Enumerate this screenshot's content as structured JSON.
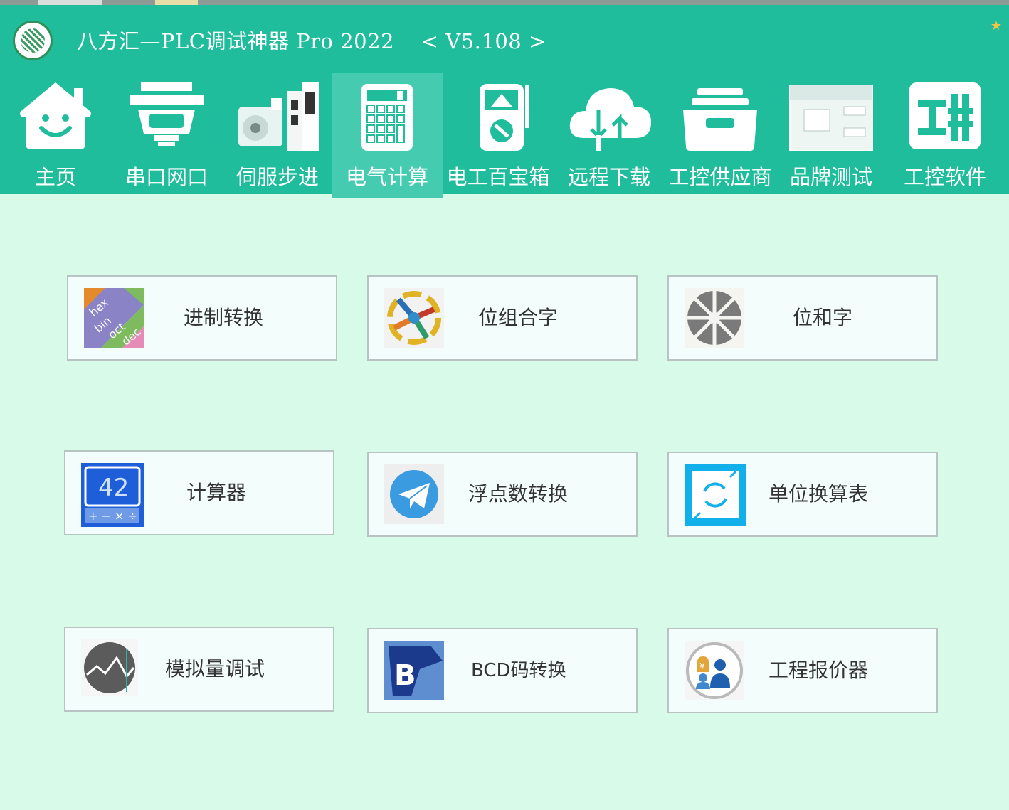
{
  "app": {
    "title": "八方汇—PLC调试神器 Pro 2022",
    "version": "< V5.108 >",
    "accent_color": "#1fbd9b",
    "background_color": "#d8fbe9"
  },
  "nav": {
    "items": [
      {
        "label": "主页",
        "icon": "home-icon"
      },
      {
        "label": "串口网口",
        "icon": "serial-port-icon"
      },
      {
        "label": "伺服步进",
        "icon": "servo-motor-icon"
      },
      {
        "label": "电气计算",
        "icon": "calculator-icon",
        "active": true
      },
      {
        "label": "电工百宝箱",
        "icon": "multimeter-icon"
      },
      {
        "label": "远程下载",
        "icon": "cloud-transfer-icon"
      },
      {
        "label": "工控供应商",
        "icon": "drawer-icon"
      },
      {
        "label": "品牌测试",
        "icon": "plc-device-icon"
      },
      {
        "label": "工控软件",
        "icon": "software-icon"
      }
    ]
  },
  "tools": [
    {
      "label": "进制转换",
      "icon": "base-conversion-icon"
    },
    {
      "label": "位组合字",
      "icon": "bit-combine-icon"
    },
    {
      "label": "位和字",
      "icon": "bit-word-icon"
    },
    {
      "label": "计算器",
      "icon": "calculator-app-icon"
    },
    {
      "label": "浮点数转换",
      "icon": "float-convert-icon"
    },
    {
      "label": "单位换算表",
      "icon": "unit-table-icon"
    },
    {
      "label": "模拟量调试",
      "icon": "analog-debug-icon"
    },
    {
      "label": "BCD码转换",
      "icon": "bcd-convert-icon"
    },
    {
      "label": "工程报价器",
      "icon": "quotation-icon"
    }
  ]
}
